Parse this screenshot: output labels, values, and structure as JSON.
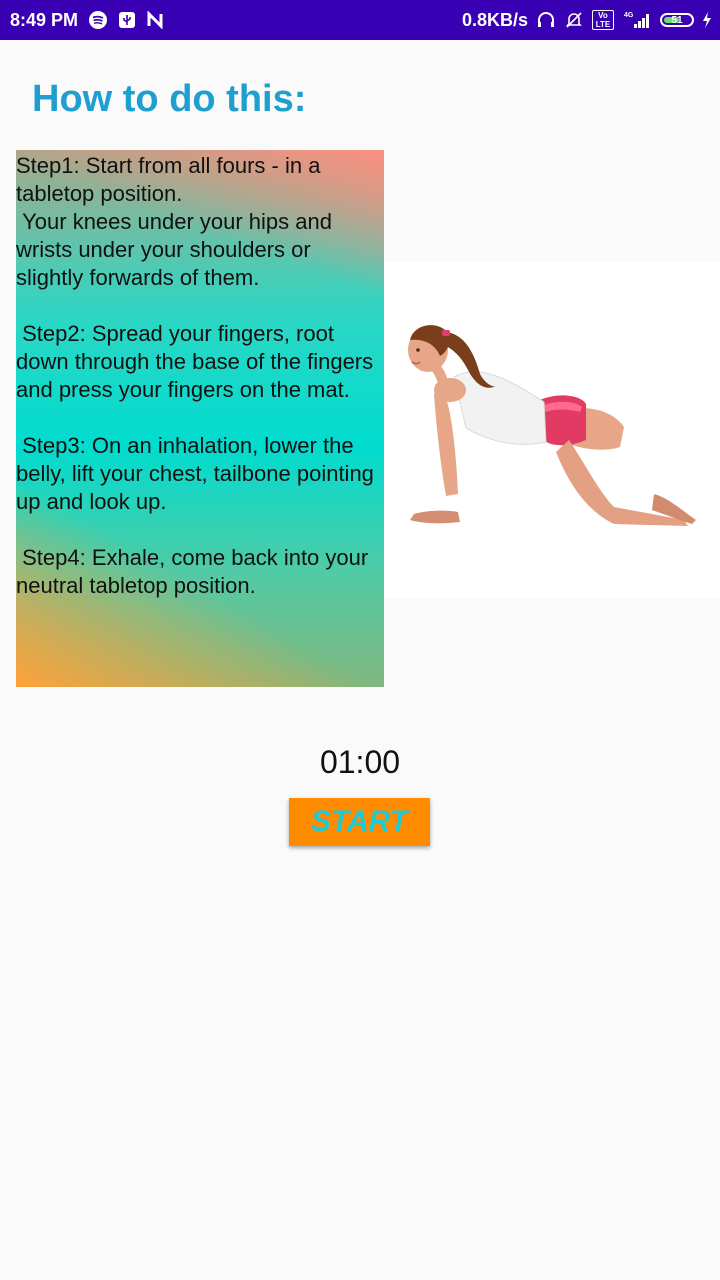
{
  "status_bar": {
    "time": "8:49 PM",
    "network_speed": "0.8KB/s",
    "signal_label": "4G",
    "volte_label": "Vo LTE",
    "battery_level": "51",
    "icons": [
      "spotify-icon",
      "usb-icon",
      "n-icon",
      "headset-icon",
      "mute-bell-icon",
      "volte-icon",
      "signal-icon",
      "battery-icon",
      "charging-icon"
    ],
    "background": "#3a00b3"
  },
  "page": {
    "title": "How to do this:",
    "title_color": "#1f9fd0",
    "steps_text": "Step1: Start from all fours - in a tabletop position.\n Your knees under your hips and wrists under your shoulders or slightly forwards of them.\n\n Step2: Spread your fingers, root down through the base of the fingers and press your fingers on the mat.\n\n Step3: On an inhalation, lower the belly, lift your chest, tailbone pointing up and look up.\n\n Step4: Exhale, come back into your neutral tabletop position.",
    "illustration": "cow-pose-illustration"
  },
  "timer": {
    "value": "01:00"
  },
  "start_button": {
    "label": "START",
    "background": "#ff8c00",
    "text_color": "#1ec9d8"
  }
}
